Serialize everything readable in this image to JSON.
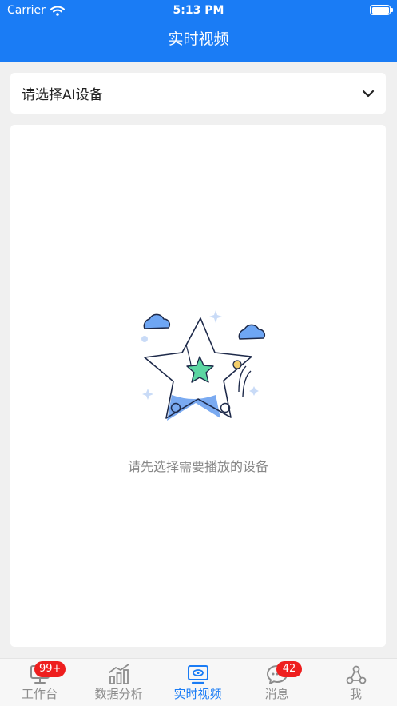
{
  "status_bar": {
    "carrier": "Carrier",
    "time": "5:13 PM"
  },
  "nav": {
    "title": "实时视频"
  },
  "selector": {
    "placeholder": "请选择AI设备"
  },
  "empty_state": {
    "message": "请先选择需要播放的设备"
  },
  "tabs": [
    {
      "label": "工作台",
      "icon": "workbench-icon",
      "badge": "99+"
    },
    {
      "label": "数据分析",
      "icon": "chart-icon",
      "badge": ""
    },
    {
      "label": "实时视频",
      "icon": "monitor-icon",
      "badge": "",
      "active": true
    },
    {
      "label": "消息",
      "icon": "message-icon",
      "badge": "42"
    },
    {
      "label": "我",
      "icon": "profile-icon",
      "badge": ""
    }
  ],
  "colors": {
    "primary": "#1a7cf5",
    "badge": "#ee1e1e",
    "background": "#f0f0f0"
  }
}
